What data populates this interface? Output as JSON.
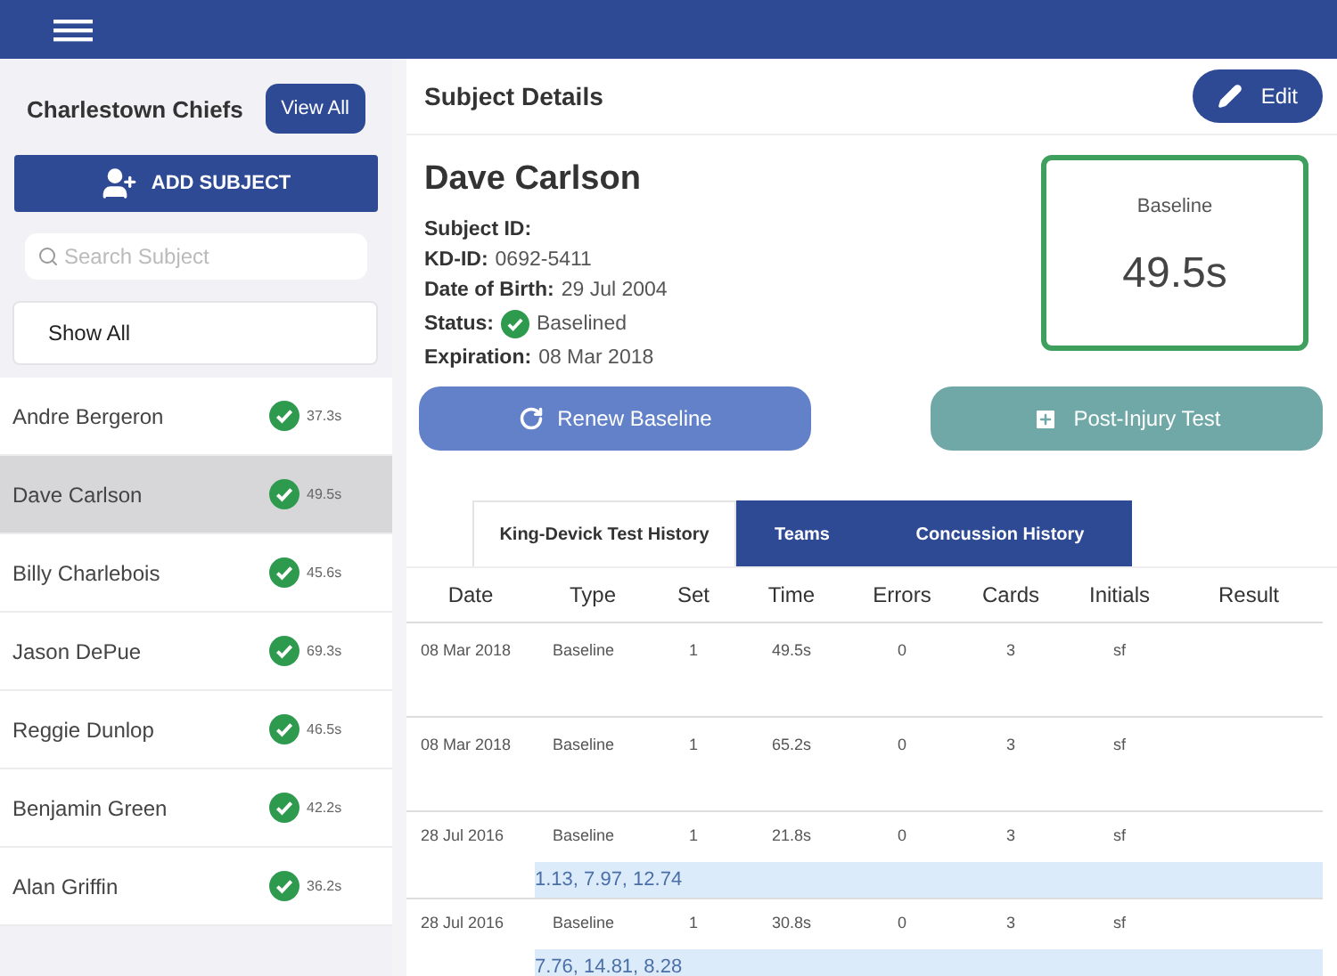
{
  "sidebar": {
    "team": "Charlestown Chiefs",
    "view_all": "View All",
    "add_subject": "ADD SUBJECT",
    "search": {
      "placeholder": "Search Subject"
    },
    "filter": "Show All",
    "subjects": [
      {
        "name": "Andre Bergeron",
        "time": "37.3s",
        "selected": false
      },
      {
        "name": "Dave Carlson",
        "time": "49.5s",
        "selected": true
      },
      {
        "name": "Billy Charlebois",
        "time": "45.6s",
        "selected": false
      },
      {
        "name": "Jason DePue",
        "time": "69.3s",
        "selected": false
      },
      {
        "name": "Reggie Dunlop",
        "time": "46.5s",
        "selected": false
      },
      {
        "name": "Benjamin Green",
        "time": "42.2s",
        "selected": false
      },
      {
        "name": "Alan Griffin",
        "time": "36.2s",
        "selected": false
      }
    ]
  },
  "header": {
    "title": "Subject Details",
    "edit": "Edit"
  },
  "subject": {
    "name": "Dave Carlson",
    "fields": [
      {
        "label": "Subject ID:"
      },
      {
        "label": "KD-ID:",
        "value": "0692-5411"
      },
      {
        "label": "Date of Birth:",
        "value": "29 Jul 2004"
      },
      {
        "label": "Status:",
        "value": "Baselined",
        "kind": "status"
      },
      {
        "label": "Expiration:",
        "value": "08 Mar 2018"
      }
    ],
    "baseline": {
      "label": "Baseline",
      "value": "49.5s"
    }
  },
  "actions": [
    {
      "label": "Renew Baseline",
      "kind": "renew"
    },
    {
      "label": "Post-Injury Test",
      "kind": "post"
    }
  ],
  "tabs": [
    {
      "label": "King-Devick Test History",
      "selected": true
    },
    {
      "label": "Teams",
      "selected": false
    },
    {
      "label": "Concussion History",
      "selected": false
    }
  ],
  "table": {
    "columns": [
      "Date",
      "Type",
      "Set",
      "Time",
      "Errors",
      "Cards",
      "Initials",
      "Result"
    ],
    "rows": [
      {
        "cells": [
          "08 Mar 2018",
          "Baseline",
          "1",
          "49.5s",
          "0",
          "3",
          "sf"
        ]
      },
      {
        "cells": [
          "08 Mar 2018",
          "Baseline",
          "1",
          "65.2s",
          "0",
          "3",
          "sf"
        ]
      },
      {
        "cells": [
          "28 Jul 2016",
          "Baseline",
          "1",
          "21.8s",
          "0",
          "3",
          "sf"
        ],
        "cards": "1.13, 7.97, 12.74"
      },
      {
        "cells": [
          "28 Jul 2016",
          "Baseline",
          "1",
          "30.8s",
          "0",
          "3",
          "sf"
        ],
        "cards": "7.76, 14.81, 8.28"
      }
    ]
  }
}
